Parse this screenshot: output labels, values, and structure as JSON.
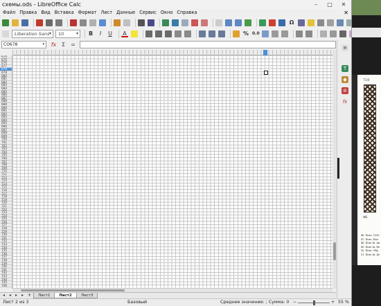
{
  "window": {
    "title": "схемы.ods - LibreOffice Calc",
    "controls": [
      "–",
      "□",
      "✕"
    ]
  },
  "menubar": {
    "items": [
      "Файл",
      "Правка",
      "Вид",
      "Вставка",
      "Формат",
      "Лист",
      "Данные",
      "Сервис",
      "Окно",
      "Справка"
    ],
    "close_doc": "✕"
  },
  "toolbar_format": {
    "font_name": "Liberation Sans",
    "font_size": "10"
  },
  "formula_bar": {
    "name_box": "CO678",
    "function_wizard_symbol": "fx",
    "sum_symbol": "Σ",
    "formula_symbol": "=",
    "content": ""
  },
  "grid": {
    "first_row": 674,
    "last_row": 746,
    "selected_row": "678",
    "selected_column": "CO",
    "row_numbers": [
      "674",
      "675",
      "676",
      "677",
      "678",
      "679",
      "680",
      "681",
      "682",
      "683",
      "684",
      "685",
      "686",
      "687",
      "688",
      "689",
      "690",
      "691",
      "692",
      "693",
      "694",
      "695",
      "696",
      "697",
      "698",
      "699",
      "700",
      "701",
      "702",
      "703",
      "704",
      "705",
      "706",
      "707",
      "708",
      "709",
      "710",
      "711",
      "712",
      "713",
      "714",
      "715",
      "716",
      "717",
      "718",
      "719",
      "720",
      "721",
      "722",
      "723",
      "724",
      "725",
      "726",
      "727",
      "728",
      "729",
      "730",
      "731",
      "732",
      "733",
      "734",
      "735",
      "736",
      "737",
      "738",
      "739",
      "740",
      "741",
      "742",
      "743",
      "744",
      "745",
      "746"
    ]
  },
  "sheet_tabs": {
    "tabs": [
      "Лист1",
      "Лист2",
      "Лист3"
    ],
    "active": "Лист2",
    "add_symbol": "+"
  },
  "status_bar": {
    "sheet_position": "Лист 2 из 3",
    "page_style": "Базовый",
    "summary": "Среднее значение: ; Сумма: 0",
    "zoom_minus": "−",
    "zoom_plus": "+",
    "zoom_level": "55 %"
  },
  "side_document": {
    "page_number": "720",
    "figure_number": "46",
    "captions": [
      "46. Пояс. 1930-",
      "47. Пояс. Нал",
      "48. Пояс (н. Ан",
      "49. Пояс (н. Не",
      "50. Пояс. Обр",
      "51. Пояс (н. Де"
    ]
  }
}
